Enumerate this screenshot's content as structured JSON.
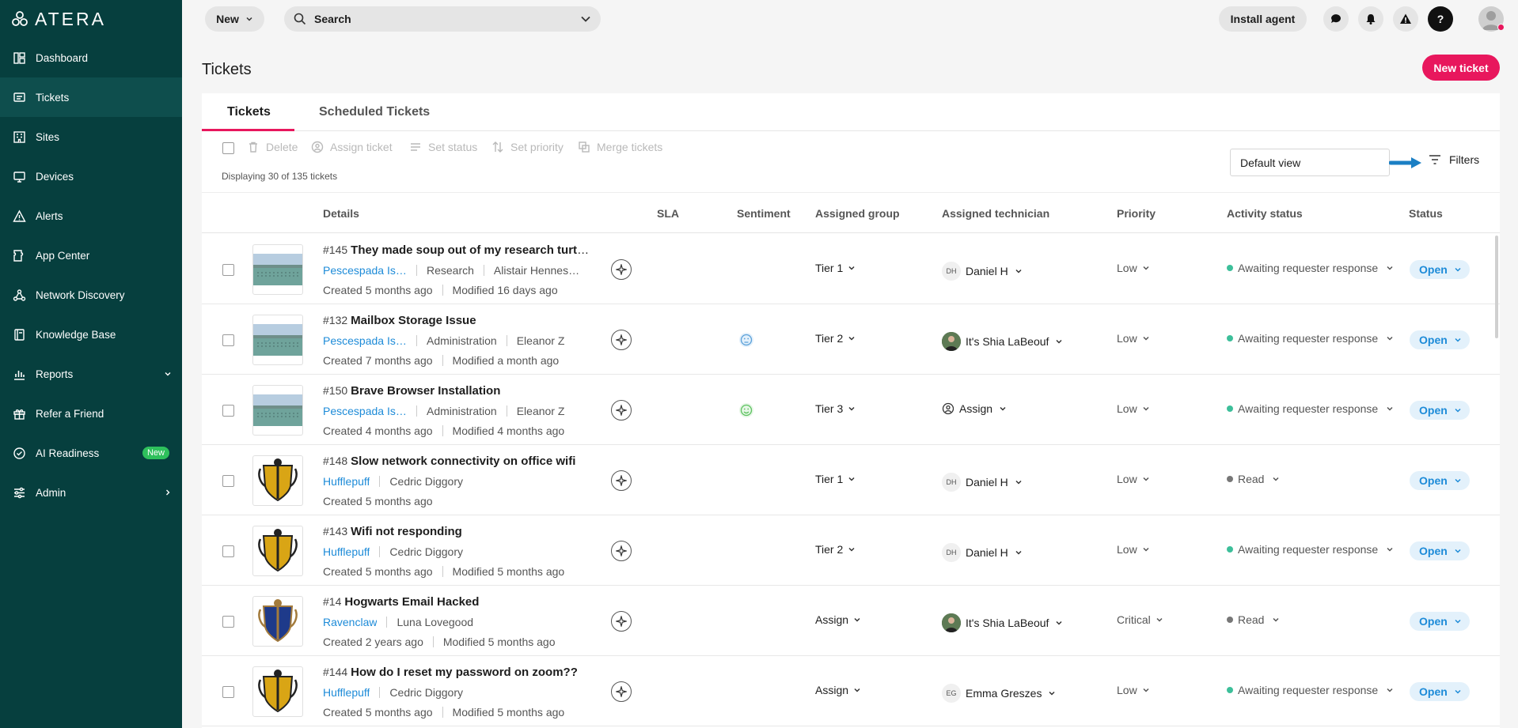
{
  "app": {
    "logo_text": "ATERA"
  },
  "sidebar": {
    "items": [
      {
        "label": "Dashboard",
        "icon": "dashboard-icon"
      },
      {
        "label": "Tickets",
        "icon": "tickets-icon",
        "active": true
      },
      {
        "label": "Sites",
        "icon": "sites-icon"
      },
      {
        "label": "Devices",
        "icon": "devices-icon"
      },
      {
        "label": "Alerts",
        "icon": "alerts-icon"
      },
      {
        "label": "App Center",
        "icon": "app-center-icon"
      },
      {
        "label": "Network Discovery",
        "icon": "network-discovery-icon"
      },
      {
        "label": "Knowledge Base",
        "icon": "knowledge-base-icon"
      },
      {
        "label": "Reports",
        "icon": "reports-icon",
        "expand": "chevron-down-icon"
      },
      {
        "label": "Refer a Friend",
        "icon": "gift-icon"
      },
      {
        "label": "AI Readiness",
        "icon": "ai-readiness-icon",
        "badge": "New"
      },
      {
        "label": "Admin",
        "icon": "admin-icon",
        "expand": "chevron-right-icon"
      }
    ]
  },
  "topbar": {
    "new_label": "New",
    "search_placeholder": "Search",
    "install_label": "Install agent"
  },
  "page": {
    "title": "Tickets",
    "new_ticket_label": "New ticket"
  },
  "tabs": [
    {
      "label": "Tickets",
      "active": true
    },
    {
      "label": "Scheduled Tickets",
      "active": false
    }
  ],
  "toolbar": {
    "delete": "Delete",
    "assign": "Assign ticket",
    "set_status": "Set status",
    "set_priority": "Set priority",
    "merge": "Merge tickets",
    "displaying": "Displaying 30 of 135 tickets",
    "view": "Default view",
    "filters": "Filters"
  },
  "columns": [
    "Details",
    "SLA",
    "Sentiment",
    "Assigned group",
    "Assigned technician",
    "Priority",
    "Activity status",
    "Status"
  ],
  "tickets": [
    {
      "num": "#145",
      "title": "They made soup out of my research turtl…",
      "site": "Pescespada Isl…",
      "dept": "Research",
      "requester": "Alistair Hennes…",
      "created": "Created 5 months ago",
      "modified": "Modified 16 days ago",
      "sentiment": "",
      "group": "Tier 1",
      "tech": "Daniel H",
      "tech_initials": "DH",
      "tech_type": "initials",
      "priority": "Low",
      "activity": "Awaiting requester response",
      "activity_color": "#3dbf9a",
      "status": "Open",
      "thumb": "landscape"
    },
    {
      "num": "#132",
      "title": "Mailbox Storage Issue",
      "site": "Pescespada Isl…",
      "dept": "Administration",
      "requester": "Eleanor Z",
      "created": "Created 7 months ago",
      "modified": "Modified a month ago",
      "sentiment": "neutral",
      "group": "Tier 2",
      "tech": "It's Shia LaBeouf",
      "tech_initials": "",
      "tech_type": "photo",
      "priority": "Low",
      "activity": "Awaiting requester response",
      "activity_color": "#3dbf9a",
      "status": "Open",
      "thumb": "landscape"
    },
    {
      "num": "#150",
      "title": "Brave Browser Installation",
      "site": "Pescespada Isl…",
      "dept": "Administration",
      "requester": "Eleanor Z",
      "created": "Created 4 months ago",
      "modified": "Modified 4 months ago",
      "sentiment": "happy",
      "group": "Tier 3",
      "tech": "Assign",
      "tech_initials": "",
      "tech_type": "assign",
      "priority": "Low",
      "activity": "Awaiting requester response",
      "activity_color": "#3dbf9a",
      "status": "Open",
      "thumb": "landscape"
    },
    {
      "num": "#148",
      "title": "Slow network connectivity on office wifi",
      "site": "Hufflepuff",
      "dept": "",
      "requester": "Cedric Diggory",
      "created": "Created 5 months ago",
      "modified": "",
      "sentiment": "",
      "group": "Tier 1",
      "tech": "Daniel H",
      "tech_initials": "DH",
      "tech_type": "initials",
      "priority": "Low",
      "activity": "Read",
      "activity_color": "#777777",
      "status": "Open",
      "thumb": "hufflepuff"
    },
    {
      "num": "#143",
      "title": "Wifi not responding",
      "site": "Hufflepuff",
      "dept": "",
      "requester": "Cedric Diggory",
      "created": "Created 5 months ago",
      "modified": "Modified 5 months ago",
      "sentiment": "",
      "group": "Tier 2",
      "tech": "Daniel H",
      "tech_initials": "DH",
      "tech_type": "initials",
      "priority": "Low",
      "activity": "Awaiting requester response",
      "activity_color": "#3dbf9a",
      "status": "Open",
      "thumb": "hufflepuff"
    },
    {
      "num": "#14",
      "title": "Hogwarts Email Hacked",
      "site": "Ravenclaw",
      "dept": "",
      "requester": "Luna Lovegood",
      "created": "Created 2 years ago",
      "modified": "Modified 5 months ago",
      "sentiment": "",
      "group": "Assign",
      "tech": "It's Shia LaBeouf",
      "tech_initials": "",
      "tech_type": "photo",
      "priority": "Critical",
      "activity": "Read",
      "activity_color": "#777777",
      "status": "Open",
      "thumb": "ravenclaw"
    },
    {
      "num": "#144",
      "title": "How do I reset my password on zoom??",
      "site": "Hufflepuff",
      "dept": "",
      "requester": "Cedric Diggory",
      "created": "Created 5 months ago",
      "modified": "Modified 5 months ago",
      "sentiment": "",
      "group": "Assign",
      "tech": "Emma Greszes",
      "tech_initials": "EG",
      "tech_type": "initials",
      "priority": "Low",
      "activity": "Awaiting requester response",
      "activity_color": "#3dbf9a",
      "status": "Open",
      "thumb": "hufflepuff"
    }
  ],
  "colors": {
    "sidebar": "#063f3e",
    "accent": "#e8175d",
    "link": "#1d8bd8",
    "status_bg": "#e3f1fb"
  }
}
